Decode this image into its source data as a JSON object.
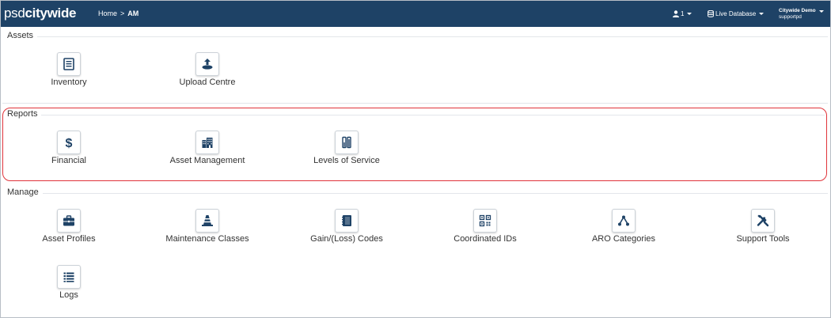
{
  "header": {
    "logo_prefix": "psd",
    "logo_main": "citywide",
    "breadcrumb": {
      "home": "Home",
      "separator": ">",
      "current": "AM"
    },
    "users": {
      "count": "1",
      "icon": "user-icon"
    },
    "database": {
      "label": "Live Database",
      "icon": "database-icon"
    },
    "account": {
      "organization": "Citywide Demo",
      "username": "supportpd"
    }
  },
  "sections": {
    "assets": {
      "title": "Assets",
      "tiles": [
        {
          "label": "Inventory",
          "icon": "list-document-icon"
        },
        {
          "label": "Upload Centre",
          "icon": "upload-icon"
        }
      ]
    },
    "reports": {
      "title": "Reports",
      "tiles": [
        {
          "label": "Financial",
          "icon": "dollar-icon"
        },
        {
          "label": "Asset Management",
          "icon": "buildings-icon"
        },
        {
          "label": "Levels of Service",
          "icon": "level-bars-icon"
        }
      ]
    },
    "manage": {
      "title": "Manage",
      "tiles": [
        {
          "label": "Asset Profiles",
          "icon": "briefcase-icon"
        },
        {
          "label": "Maintenance Classes",
          "icon": "traffic-cone-icon"
        },
        {
          "label": "Gain/(Loss) Codes",
          "icon": "notebook-icon"
        },
        {
          "label": "Coordinated IDs",
          "icon": "qr-code-icon"
        },
        {
          "label": "ARO Categories",
          "icon": "hierarchy-icon"
        },
        {
          "label": "Support Tools",
          "icon": "tools-icon"
        },
        {
          "label": "Logs",
          "icon": "list-icon"
        }
      ]
    }
  },
  "colors": {
    "navbar": "#1e4266",
    "icon": "#1e4266",
    "highlight": "#e0333a"
  }
}
